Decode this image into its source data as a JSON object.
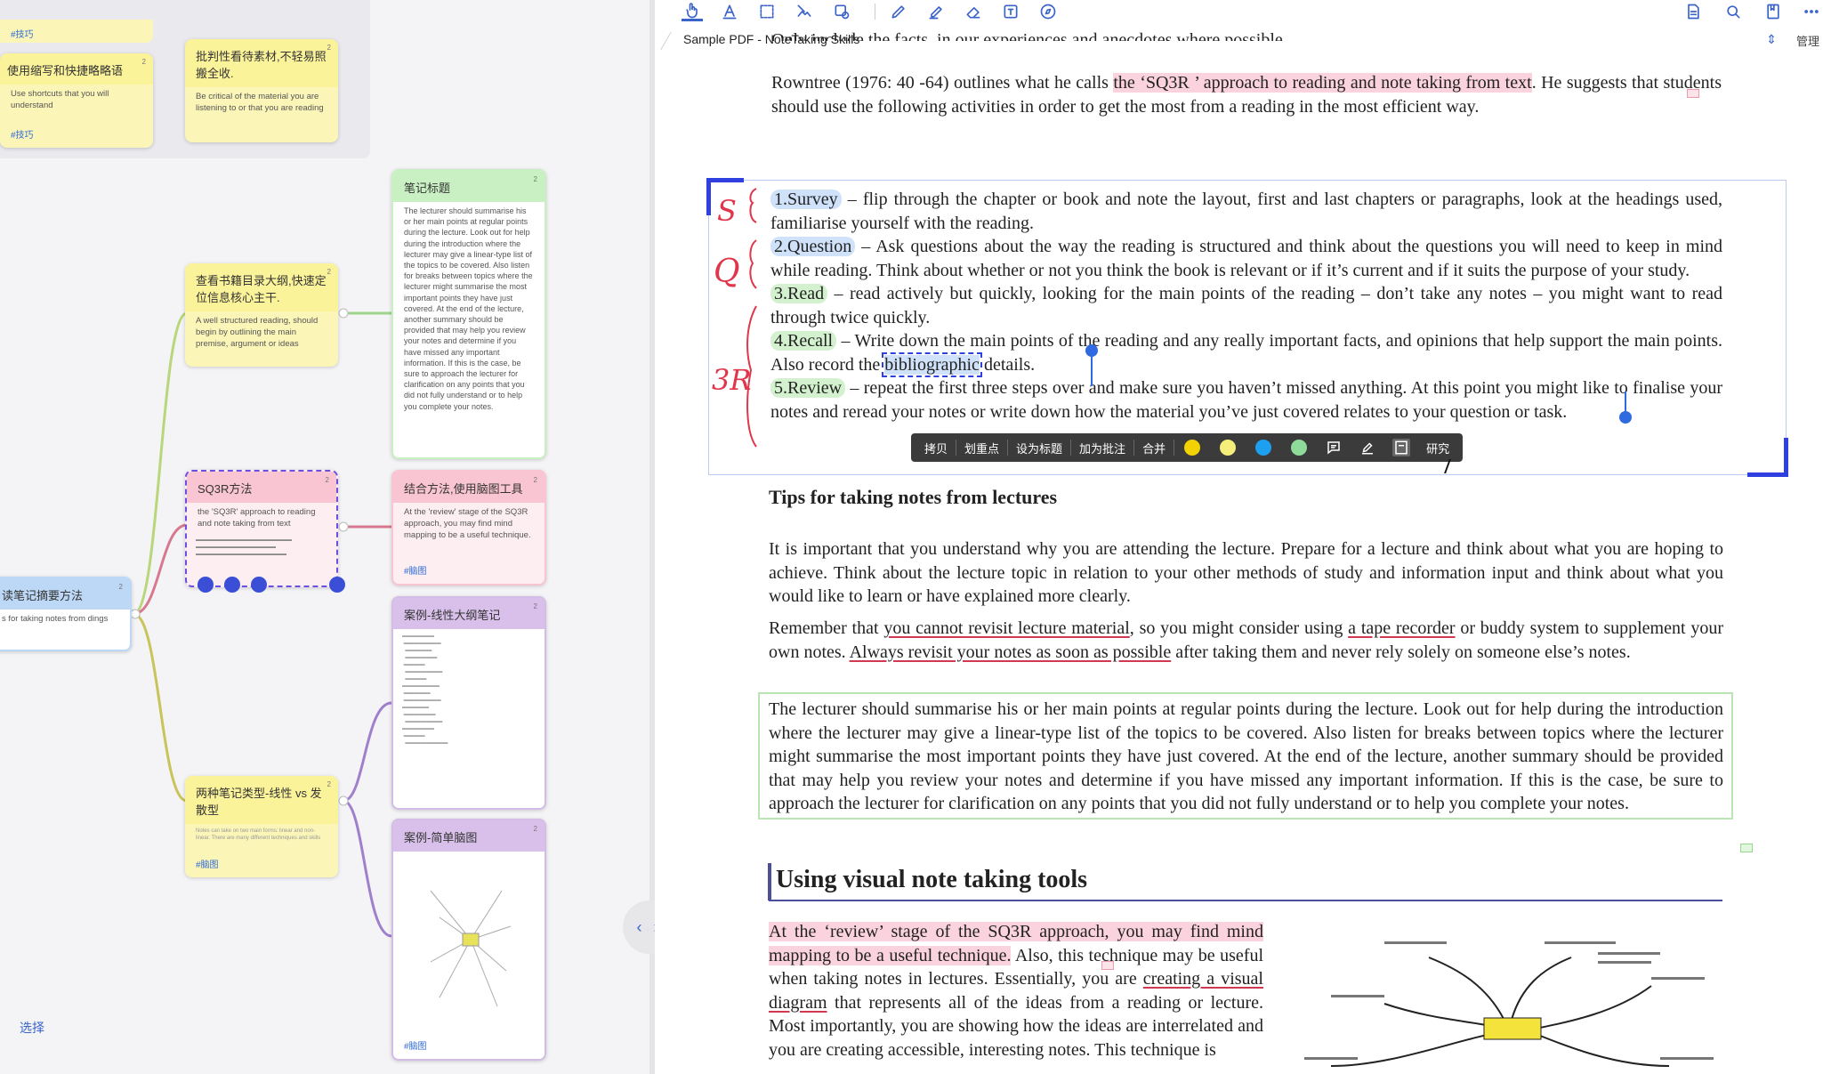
{
  "left_panel": {
    "select_label": "选择",
    "cards": [
      {
        "id": "c-shortcuts",
        "header": "使用缩写和快捷略略语",
        "body": "Use shortcuts that you will understand",
        "tag": "#技巧",
        "num": "2"
      },
      {
        "id": "c-critical",
        "header": "批判性看待素材,不轻易照搬全收.",
        "body": "Be critical of the material you are listening to or that you are reading",
        "tag": "",
        "num": "2"
      },
      {
        "id": "c-toc",
        "header": "查看书籍目录大纲,快速定位信息核心主干.",
        "body": "A well structured reading, should begin by outlining the main premise, argument or ideas",
        "tag": "",
        "num": "2"
      },
      {
        "id": "c-notes-title",
        "header": "笔记标题",
        "body": "The lecturer should summarise his or her main points at regular points during the lecture. Look out for help during the introduction where the lecturer may give a linear-type list of the topics to be covered. Also listen for breaks between topics where the lecturer might summarise the most important points they have just covered. At the end of the lecture, another summary should be provided that may help you review your notes and determine if you have missed any important information. If this is the case, be sure to approach the lecturer for clarification on any points that you did not fully understand or to help you complete your notes.",
        "tag": "",
        "num": "2"
      },
      {
        "id": "c-sq3r",
        "header": "SQ3R方法",
        "body": "the 'SQ3R' approach to reading and note taking from text",
        "tag": "",
        "num": "2"
      },
      {
        "id": "c-mindmap",
        "header": "结合方法,使用脑图工具",
        "body": "At the 'review' stage of the SQ3R approach, you may find mind mapping to be a useful technique.",
        "tag": "#脑图",
        "num": "2"
      },
      {
        "id": "c-reading",
        "header": "读笔记摘要方法",
        "body": "s for taking notes from dings",
        "tag": "",
        "num": "2"
      },
      {
        "id": "c-linear-case",
        "header": "案例-线性大纲笔记",
        "body": "",
        "tag": "",
        "num": "2"
      },
      {
        "id": "c-two-types",
        "header": "两种笔记类型-线性 vs 发散型",
        "body": "Notes can take on two main forms: linear and non-linear. There are many different techniques and skills",
        "tag": "#脑图",
        "num": "2"
      },
      {
        "id": "c-simple-map",
        "header": "案例-简单脑图",
        "body": "",
        "tag": "#脑图",
        "num": "2"
      }
    ]
  },
  "doc": {
    "tab_title": "Sample PDF - NoteTaking Skills",
    "manage_label": "管理",
    "top_cut": "Only include the facts, in our experiences and anecdotes where possible.",
    "para1_a": "Rowntree (1976: 40 -64) outlines what he calls ",
    "para1_hl": "the ‘SQ3R ’ approach to reading and note taking from text",
    "para1_b": ". He suggests that students should use the following activities in order to get the most from a reading in the most efficient way.",
    "survey_label": "1.Survey",
    "survey_text": " – flip through the chapter or book and note the layout, first and last chapters or paragraphs, look at the headings used, familiarise yourself with the reading.",
    "question_label": "2.Question",
    "question_text": " – Ask questions about the way the reading is structured and think about the questions you will need to keep in mind while reading. Think about whether or not you think the book is relevant or if it’s current and if it suits the purpose of your study.",
    "read_label": "3.Read",
    "read_text": " – read actively but quickly, looking for the main points of the reading – don’t take any notes – you might want to read through twice quickly.",
    "recall_label": "4.Recall",
    "recall_text_a": " – Write down the main points of the reading and any really important facts, and opinions that help support the main points. Also record the ",
    "recall_sel": "bibliographic",
    "recall_text_b": " details.",
    "review_label": "5.Review",
    "review_text": " – repeat the first three steps over and make sure you haven’t missed anything. At this point you might like to finalise your notes and reread your notes or write down how the material you’ve just covered relates to your question or task.",
    "margin_s": "S",
    "margin_q": "Q",
    "margin_3r": "3R",
    "h_lectures": "Tips for taking notes from lectures",
    "p_lect1": "It is important that you understand why you are attending the lecture. Prepare for a lecture and think about what you are hoping to achieve. Think about the lecture topic in relation to your other methods of study and information input and think about what you would like to learn or have explained more clearly.",
    "p_lect2_a": "Remember that ",
    "p_lect2_u1": "you cannot revisit lecture material",
    "p_lect2_b": ", so you might consider using ",
    "p_lect2_u2": "a tape recorder",
    "p_lect2_c": " or buddy system to supplement your own notes. ",
    "p_lect2_u3": "Always revisit your notes as soon as possible",
    "p_lect2_d": " after taking them and never rely solely on someone else’s notes.",
    "p_lect3": "The lecturer should summarise his or her main points at regular points during the lecture. Look out for help during the introduction where the lecturer may give a linear-type list of the topics to be covered. Also listen for breaks between topics where the lecturer might summarise the most important points they have just covered. At the end of the lecture, another summary should be provided that may help you review your notes and determine if you have missed any important information. If this is the case, be sure to approach the lecturer for clarification on any points that you did not fully understand or to help you complete your notes.",
    "h_visual": "Using visual note taking tools",
    "p_vis_hl": "At the ‘review’ stage of the SQ3R approach, you may find mind mapping to be a useful technique.",
    "p_vis_a": " Also, this technique may be useful when taking notes in lectures. Essentially, you are ",
    "p_vis_u": "creating a visual diagram",
    "p_vis_b": " that represents all of the ideas from a reading or lecture. Most importantly, you are showing how the ideas are interrelated and you are creating accessible, interesting notes. This technique is"
  },
  "popup": {
    "copy": "拷贝",
    "key_point": "划重点",
    "set_title": "设为标题",
    "add_note": "加为批注",
    "merge": "合并",
    "research": "研究",
    "colors": [
      "#f2d200",
      "#f6ee7a",
      "#1ea0f0",
      "#8fdc9a"
    ]
  },
  "colors": {
    "accent": "#3a63c9",
    "highlight_pink": "#fbd3de",
    "highlight_blue": "#cfe2fa",
    "highlight_green": "#d3f1cf",
    "frame_blue": "#2f3fe0"
  }
}
